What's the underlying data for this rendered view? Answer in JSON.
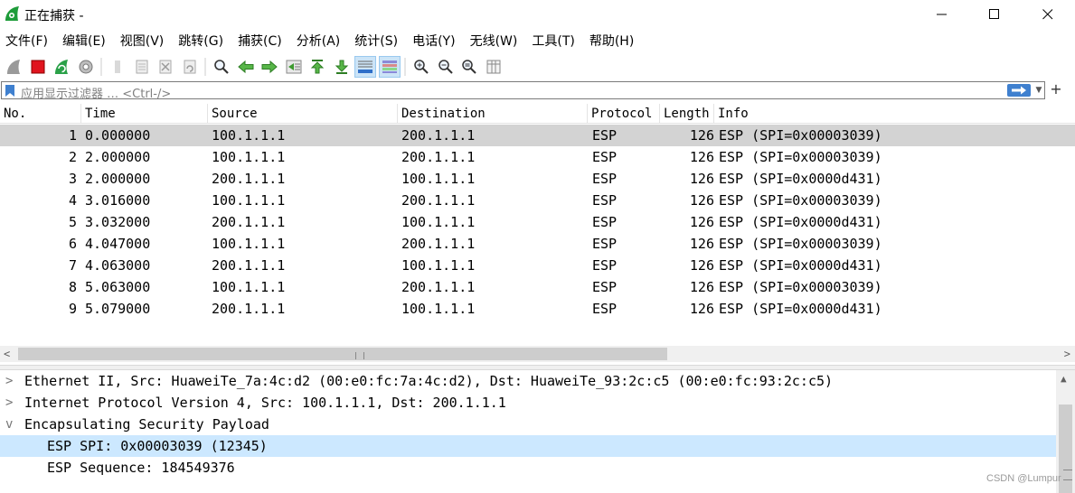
{
  "window": {
    "title": "正在捕获 -"
  },
  "menu": [
    "文件(F)",
    "编辑(E)",
    "视图(V)",
    "跳转(G)",
    "捕获(C)",
    "分析(A)",
    "统计(S)",
    "电话(Y)",
    "无线(W)",
    "工具(T)",
    "帮助(H)"
  ],
  "filter": {
    "placeholder": "应用显示过滤器 … <Ctrl-/>"
  },
  "columns": [
    "No.",
    "Time",
    "Source",
    "Destination",
    "Protocol",
    "Length",
    "Info"
  ],
  "packets": [
    {
      "no": "1",
      "time": "0.000000",
      "src": "100.1.1.1",
      "dst": "200.1.1.1",
      "proto": "ESP",
      "len": "126",
      "info": "ESP (SPI=0x00003039)"
    },
    {
      "no": "2",
      "time": "2.000000",
      "src": "100.1.1.1",
      "dst": "200.1.1.1",
      "proto": "ESP",
      "len": "126",
      "info": "ESP (SPI=0x00003039)"
    },
    {
      "no": "3",
      "time": "2.000000",
      "src": "200.1.1.1",
      "dst": "100.1.1.1",
      "proto": "ESP",
      "len": "126",
      "info": "ESP (SPI=0x0000d431)"
    },
    {
      "no": "4",
      "time": "3.016000",
      "src": "100.1.1.1",
      "dst": "200.1.1.1",
      "proto": "ESP",
      "len": "126",
      "info": "ESP (SPI=0x00003039)"
    },
    {
      "no": "5",
      "time": "3.032000",
      "src": "200.1.1.1",
      "dst": "100.1.1.1",
      "proto": "ESP",
      "len": "126",
      "info": "ESP (SPI=0x0000d431)"
    },
    {
      "no": "6",
      "time": "4.047000",
      "src": "100.1.1.1",
      "dst": "200.1.1.1",
      "proto": "ESP",
      "len": "126",
      "info": "ESP (SPI=0x00003039)"
    },
    {
      "no": "7",
      "time": "4.063000",
      "src": "200.1.1.1",
      "dst": "100.1.1.1",
      "proto": "ESP",
      "len": "126",
      "info": "ESP (SPI=0x0000d431)"
    },
    {
      "no": "8",
      "time": "5.063000",
      "src": "100.1.1.1",
      "dst": "200.1.1.1",
      "proto": "ESP",
      "len": "126",
      "info": "ESP (SPI=0x00003039)"
    },
    {
      "no": "9",
      "time": "5.079000",
      "src": "200.1.1.1",
      "dst": "100.1.1.1",
      "proto": "ESP",
      "len": "126",
      "info": "ESP (SPI=0x0000d431)"
    }
  ],
  "details": [
    {
      "text": "Ethernet II, Src: HuaweiTe_7a:4c:d2 (00:e0:fc:7a:4c:d2), Dst: HuaweiTe_93:2c:c5 (00:e0:fc:93:2c:c5)",
      "expander": ">",
      "child": false,
      "selected": false
    },
    {
      "text": "Internet Protocol Version 4, Src: 100.1.1.1, Dst: 200.1.1.1",
      "expander": ">",
      "child": false,
      "selected": false
    },
    {
      "text": "Encapsulating Security Payload",
      "expander": "v",
      "child": false,
      "selected": false
    },
    {
      "text": "ESP SPI: 0x00003039 (12345)",
      "expander": "",
      "child": true,
      "selected": true
    },
    {
      "text": "ESP Sequence: 184549376",
      "expander": "",
      "child": true,
      "selected": false
    }
  ],
  "watermark": "CSDN @Lumpur",
  "colors": {
    "selected_row": "#d3d3d3",
    "selected_detail": "#cce8ff",
    "accent": "#3f80cf"
  }
}
